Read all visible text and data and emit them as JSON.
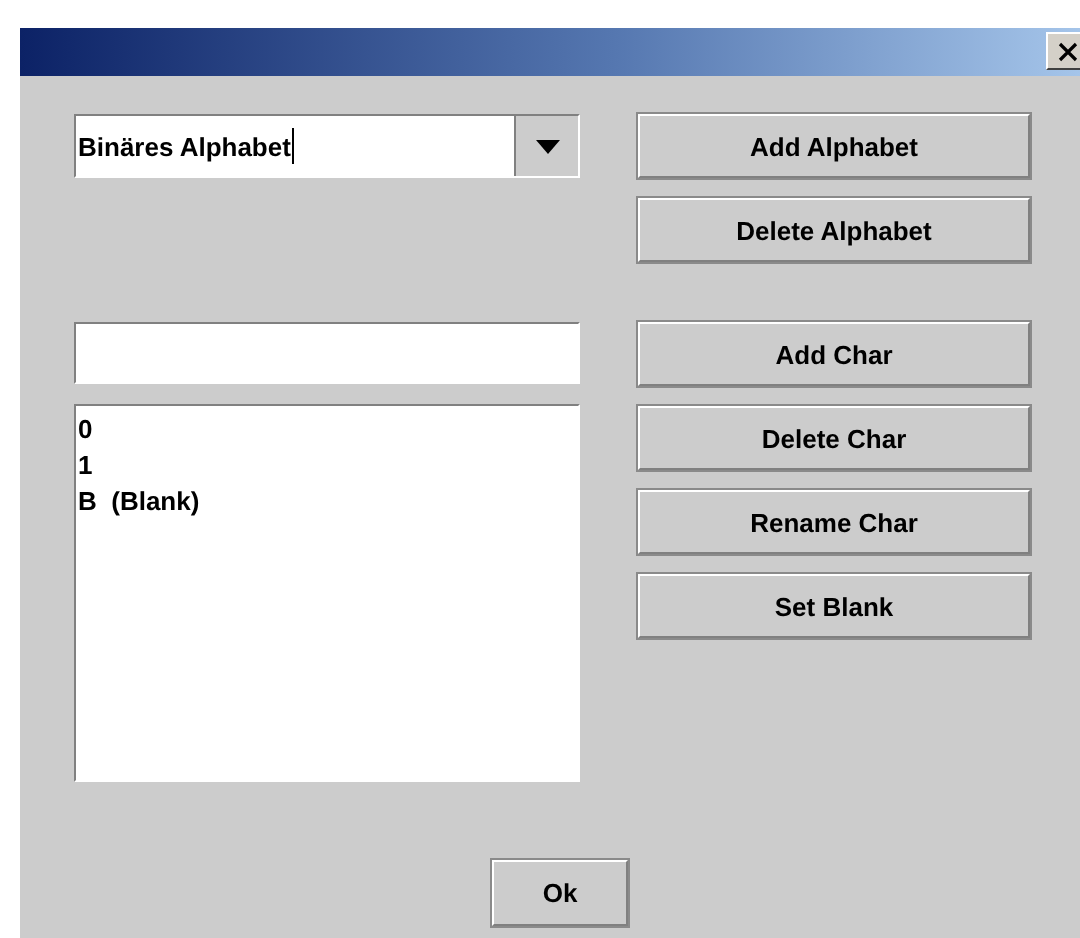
{
  "alphabet_combo": {
    "value": "Binäres Alphabet",
    "focused": true
  },
  "alphabet_buttons": [
    "Add Alphabet",
    "Delete Alphabet"
  ],
  "char_list": [
    {
      "label": "0",
      "selected": false
    },
    {
      "label": "1",
      "selected": false
    },
    {
      "label": "B  (Blank)",
      "selected": false
    }
  ],
  "char_buttons": [
    "Add Char",
    "Delete Char",
    "Rename Char",
    "Set Blank"
  ],
  "ok_button": "Ok"
}
